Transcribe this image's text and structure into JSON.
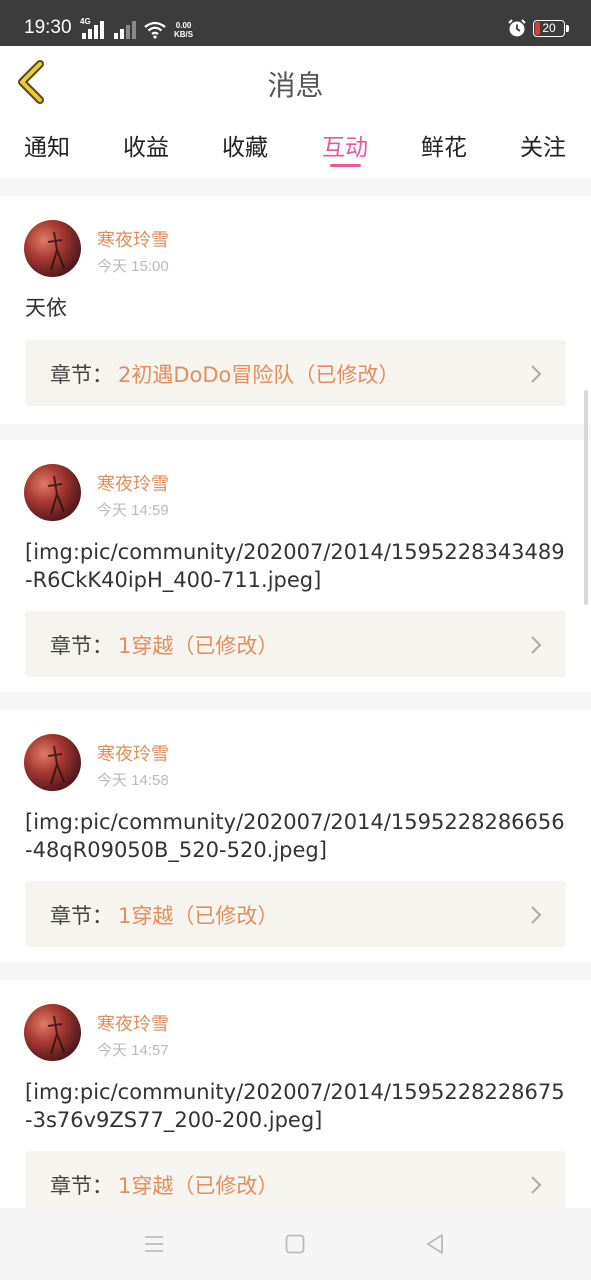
{
  "status_bar": {
    "time": "19:30",
    "network_label": "4G",
    "speed_value": "0.00",
    "speed_unit": "KB/S",
    "battery": "20"
  },
  "header": {
    "title": "消息",
    "back_icon": "chevron-left-icon"
  },
  "tabs": [
    {
      "label": "通知",
      "active": false
    },
    {
      "label": "收益",
      "active": false
    },
    {
      "label": "收藏",
      "active": false
    },
    {
      "label": "互动",
      "active": true
    },
    {
      "label": "鲜花",
      "active": false
    },
    {
      "label": "关注",
      "active": false
    }
  ],
  "accent_color": "#e5589a",
  "name_color": "#e58d5c",
  "messages": [
    {
      "user": "寒夜玲雪",
      "time": "今天 15:00",
      "content": "天依",
      "chapter_label": "章节：",
      "chapter": "2初遇DoDo冒险队（已修改）"
    },
    {
      "user": "寒夜玲雪",
      "time": "今天 14:59",
      "content": "[img:pic/community/202007/2014/1595228343489-R6CkK40ipH_400-711.jpeg]",
      "chapter_label": "章节：",
      "chapter": "1穿越（已修改）"
    },
    {
      "user": "寒夜玲雪",
      "time": "今天 14:58",
      "content": "[img:pic/community/202007/2014/1595228286656-48qR09050B_520-520.jpeg]",
      "chapter_label": "章节：",
      "chapter": "1穿越（已修改）"
    },
    {
      "user": "寒夜玲雪",
      "time": "今天 14:57",
      "content": "[img:pic/community/202007/2014/1595228228675-3s76v9ZS77_200-200.jpeg]",
      "chapter_label": "章节：",
      "chapter": "1穿越（已修改）"
    }
  ]
}
